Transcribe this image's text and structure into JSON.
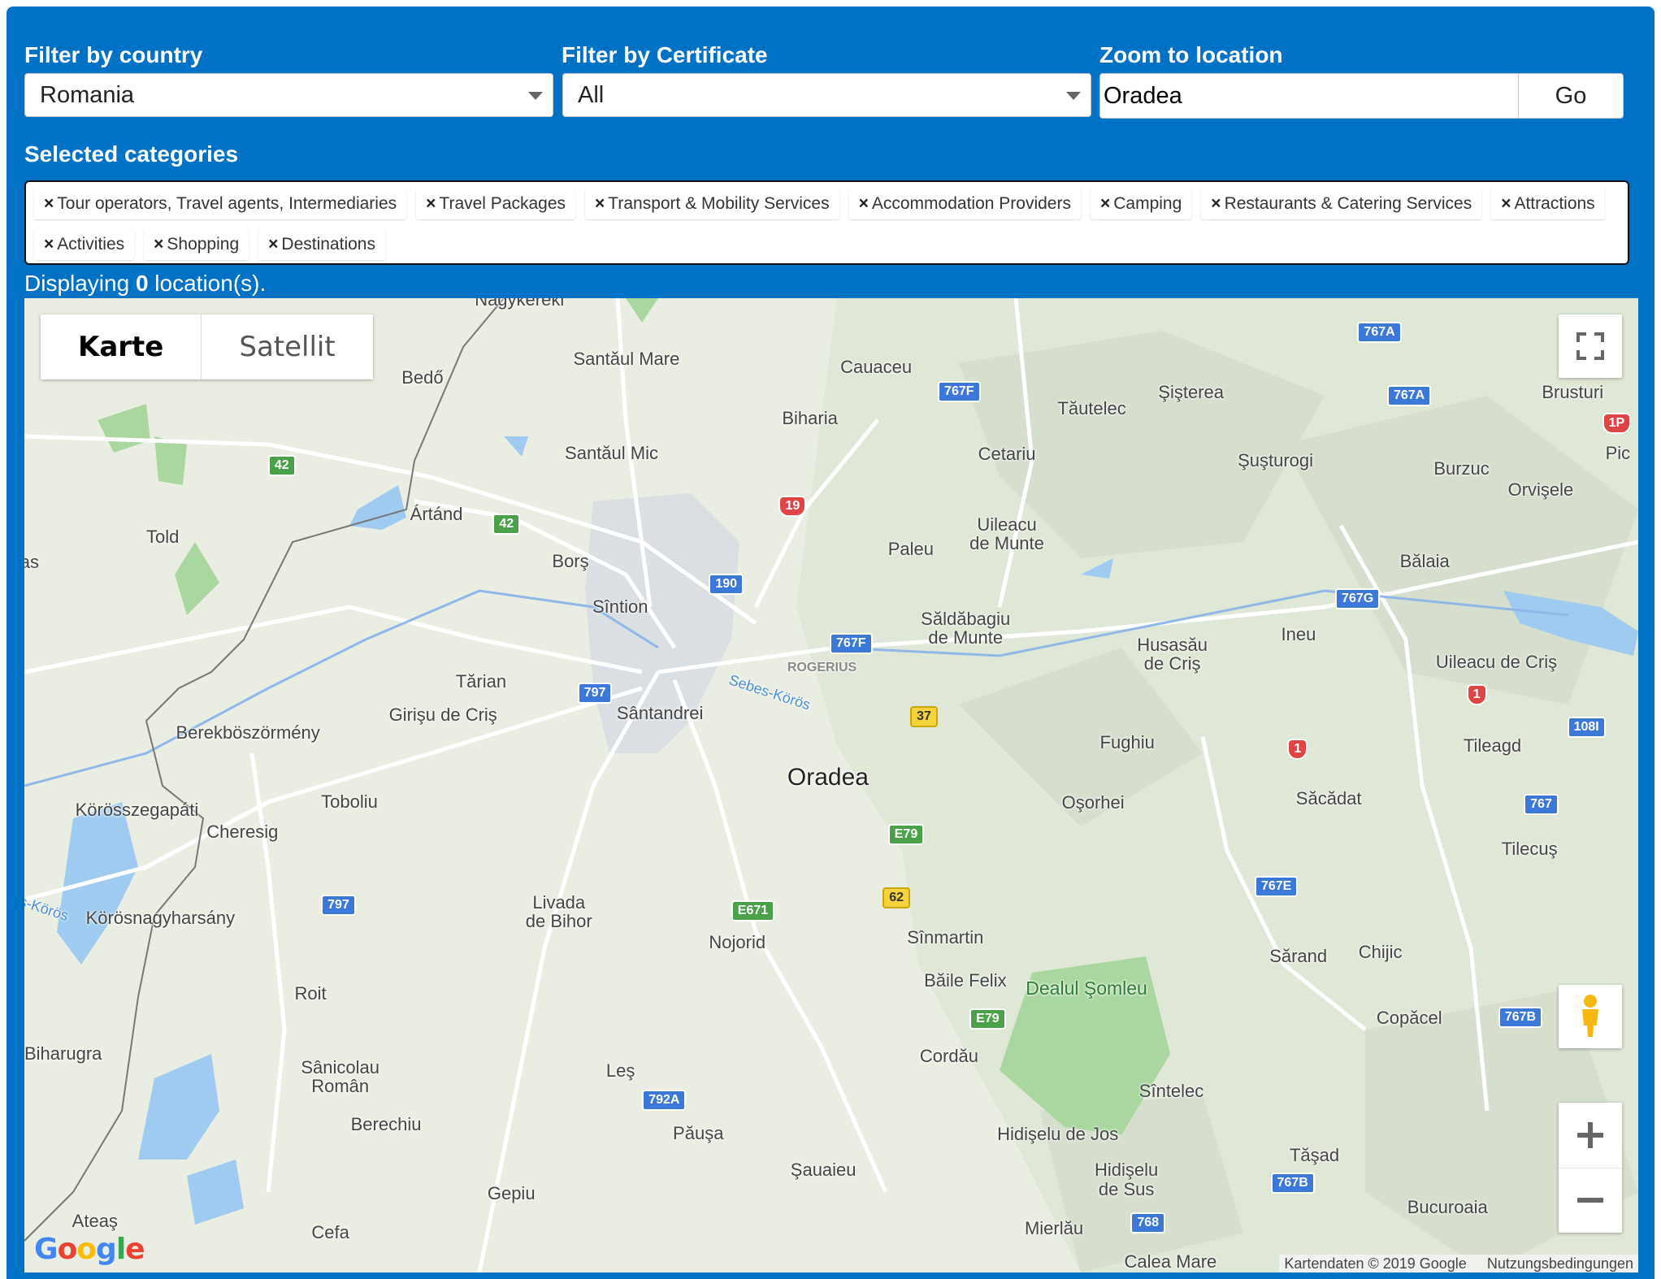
{
  "filters": {
    "country_label": "Filter by country",
    "country_value": "Romania",
    "certificate_label": "Filter by Certificate",
    "certificate_value": "All",
    "zoom_label": "Zoom to location",
    "zoom_value": "Oradea",
    "go_label": "Go"
  },
  "categories": {
    "label": "Selected categories",
    "remove_glyph": "×",
    "items": [
      "Tour operators, Travel agents, Intermediaries",
      "Travel Packages",
      "Transport & Mobility Services",
      "Accommodation Providers",
      "Camping",
      "Restaurants & Catering Services",
      "Attractions",
      "Activities",
      "Shopping",
      "Destinations"
    ]
  },
  "status": {
    "prefix": "Displaying ",
    "count": "0",
    "suffix": " location(s)."
  },
  "map": {
    "map_type_active": "Karte",
    "map_type_other": "Satellit",
    "attribution": "Kartendaten © 2019 Google",
    "terms": "Nutzungsbedingungen",
    "logo_letters": [
      "G",
      "o",
      "o",
      "g",
      "l",
      "e"
    ],
    "logo_colors": [
      "#4285f4",
      "#ea4335",
      "#fbbc05",
      "#4285f4",
      "#34a853",
      "#ea4335"
    ],
    "place_labels": {
      "oradea": "Oradea",
      "nagykereki": "Nagykereki",
      "santaul_mare": "Santăul Mare",
      "bedo": "Bedő",
      "cauaceu": "Cauaceu",
      "biharia": "Biharia",
      "tautelec": "Tăutelec",
      "sisterea": "Şişterea",
      "brusturi": "Brusturi",
      "santaul_mic": "Santăul Mic",
      "cetariu": "Cetariu",
      "susturogi": "Şuşturogi",
      "burzuc": "Burzuc",
      "orviscle": "Orvişele",
      "pic": "Pic",
      "told": "Told",
      "artand": "Ártánd",
      "uileacu_munte": "Uileacu\nde Munte",
      "paleu": "Paleu",
      "bors": "Borş",
      "balaia": "Bălaia",
      "sintion": "Sîntion",
      "saldabagiu": "Săldăbagiu\nde Munte",
      "ineu": "Ineu",
      "husasau": "Husasău\nde Criş",
      "rogerius": "ROGERIUS",
      "tarian": "Tărian",
      "uileacu_cris": "Uileacu de Criş",
      "girisu": "Girişu de Criş",
      "santandrei": "Sântandrei",
      "sebes_koros": "Sebes-Körös",
      "berekbo": "Berekböszörmény",
      "fughiu": "Fughiu",
      "tileagd": "Tileagd",
      "osorhei": "Oşorhei",
      "sacadat": "Săcădat",
      "korosszeg": "Körösszegapáti",
      "toboliu": "Toboliu",
      "cheresig": "Cheresig",
      "tilecus": "Tilecuş",
      "livada": "Livada\nde Bihor",
      "korosnagy": "Körösnagyharsány",
      "nojorid": "Nojorid",
      "sinmartin": "Sînmartin",
      "sarand": "Sărand",
      "chijic": "Chijic",
      "baile_felix": "Băile Felix",
      "dealul_somleu": "Dealul Şomleu",
      "roit": "Roit",
      "copacel": "Copăcel",
      "biharugra": "Biharugra",
      "cordau": "Cordău",
      "sanicolau": "Sânicolau\nRomân",
      "les": "Leş",
      "sintelec": "Sîntelec",
      "berechiu": "Berechiu",
      "pausa": "Păuşa",
      "hidiselu_jos": "Hidişelu de Jos",
      "tasad": "Tăşad",
      "saulieu": "Şauaieu",
      "hidiselu_sus": "Hidişelu\nde Sus",
      "gepiu": "Gepiu",
      "bucuroaia": "Bucuroaia",
      "ateas": "Ateaş",
      "cefa": "Cefa",
      "mierlau": "Mierlău",
      "calea_mare": "Calea Mare",
      "koros_left": "s-Körös",
      "as": "as"
    },
    "road_shields": {
      "r42a": "42",
      "r42b": "42",
      "r19": "19",
      "r190": "190",
      "r767f_top": "767F",
      "r767f_mid": "767F",
      "r767a_1": "767A",
      "r767a_2": "767A",
      "r1p": "1P",
      "r767g": "767G",
      "r797_a": "797",
      "r37": "37",
      "r1_a": "1",
      "r1_b": "1",
      "r108i": "108I",
      "r767": "767",
      "re79_a": "E79",
      "r62": "62",
      "r797_b": "797",
      "re671": "E671",
      "r767e": "767E",
      "re79_b": "E79",
      "r767b_a": "767B",
      "r792a": "792A",
      "r767b_b": "767B",
      "r768": "768"
    }
  }
}
